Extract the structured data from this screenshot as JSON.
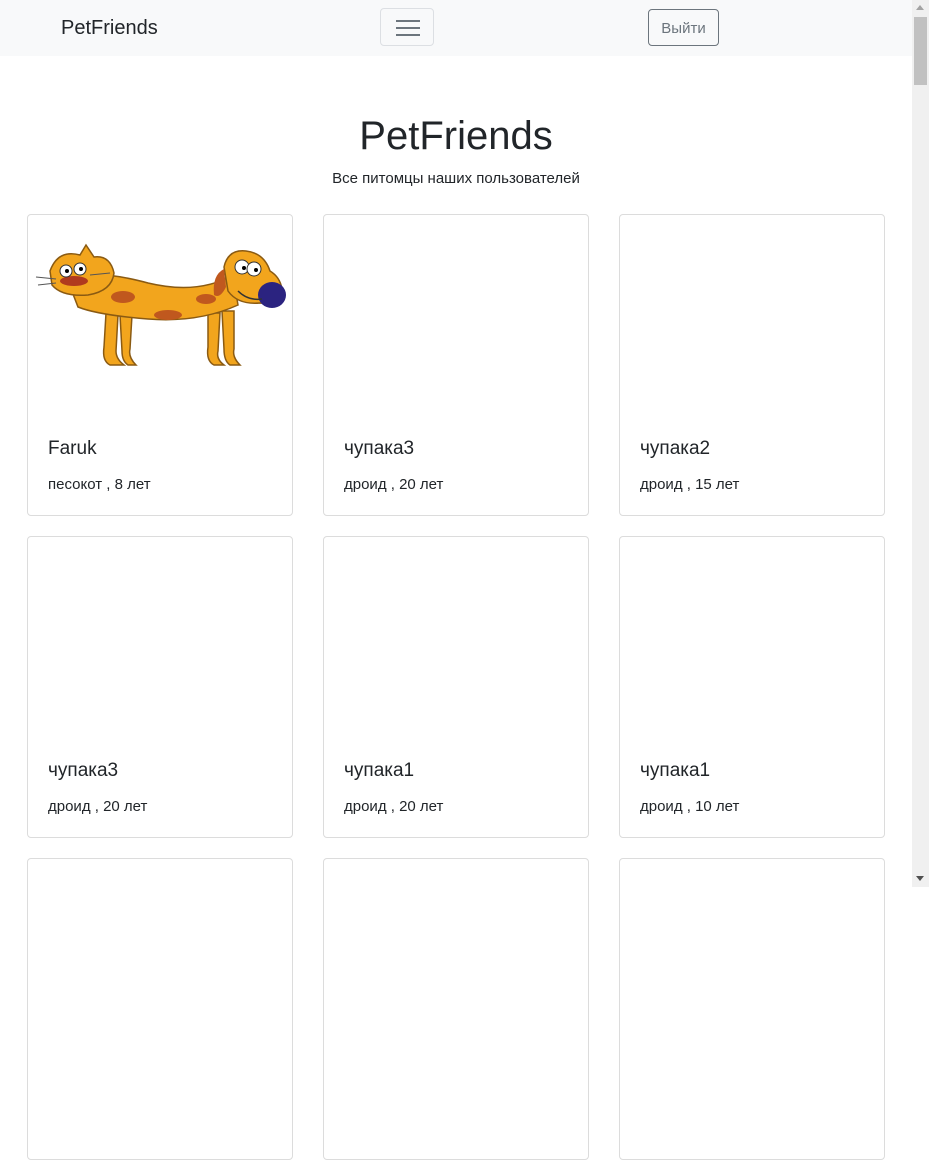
{
  "navbar": {
    "brand": "PetFriends",
    "toggler_icon": "hamburger-icon",
    "logout_label": "Выйти"
  },
  "page": {
    "title": "PetFriends",
    "subtitle": "Все питомцы наших пользователей"
  },
  "cards": [
    {
      "name": "Faruk",
      "info": "песокот , 8 лет",
      "has_photo": true
    },
    {
      "name": "чупака3",
      "info": "дроид , 20 лет",
      "has_photo": false
    },
    {
      "name": "чупака2",
      "info": "дроид , 15 лет",
      "has_photo": false
    },
    {
      "name": "чупака3",
      "info": "дроид , 20 лет",
      "has_photo": false
    },
    {
      "name": "чупака1",
      "info": "дроид , 20 лет",
      "has_photo": false
    },
    {
      "name": "чупака1",
      "info": "дроид , 10 лет",
      "has_photo": false
    },
    {
      "name": "",
      "info": "",
      "has_photo": false
    },
    {
      "name": "",
      "info": "",
      "has_photo": false
    },
    {
      "name": "",
      "info": "",
      "has_photo": false
    }
  ],
  "colors": {
    "navbar_bg": "#f8f9fa",
    "text": "#212529",
    "secondary": "#6c757d",
    "card_border": "#dcdcdc"
  }
}
